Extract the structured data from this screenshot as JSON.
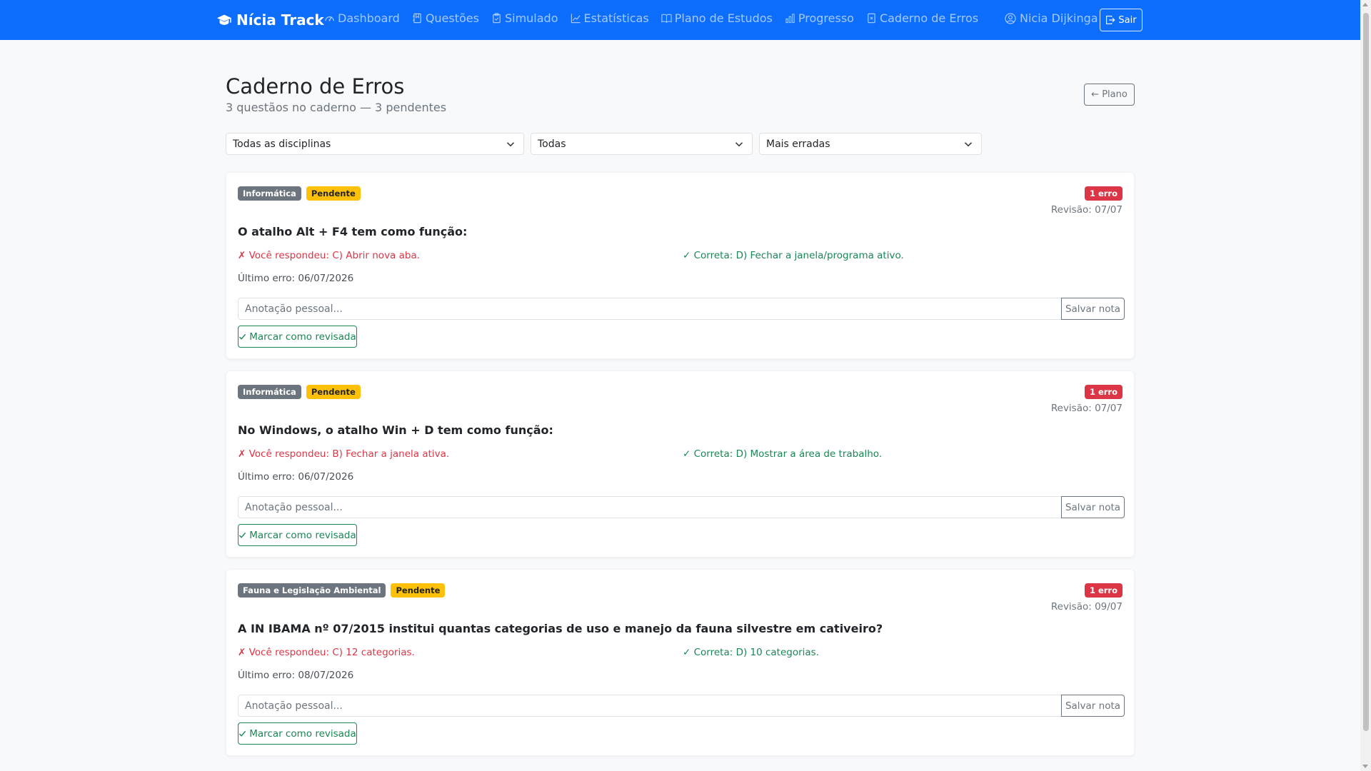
{
  "navbar": {
    "brand": "Nícia Track",
    "links": [
      {
        "label": "Dashboard",
        "icon": "speedometer-icon"
      },
      {
        "label": "Questões",
        "icon": "journal-icon"
      },
      {
        "label": "Simulado",
        "icon": "clipboard-icon"
      },
      {
        "label": "Estatísticas",
        "icon": "graph-up-icon"
      },
      {
        "label": "Plano de Estudos",
        "icon": "book-icon"
      },
      {
        "label": "Progresso",
        "icon": "bar-chart-icon"
      },
      {
        "label": "Caderno de Erros",
        "icon": "journal-x-icon"
      }
    ],
    "user": "Nicia Dijkinga",
    "logout": "Sair"
  },
  "header": {
    "title": "Caderno de Erros",
    "subtitle": "3 questãos no caderno — 3 pendentes",
    "back_button": "← Plano"
  },
  "filters": {
    "discipline": "Todas as disciplinas",
    "status": "Todas",
    "order": "Mais erradas"
  },
  "cards": [
    {
      "discipline": "Informática",
      "status": "Pendente",
      "errors": "1 erro",
      "revisao": "Revisão: 07/07",
      "question": "O atalho Alt + F4 tem como função:",
      "wrong": "✗ Você respondeu: C) Abrir nova aba.",
      "correct": "✓ Correta: D) Fechar a janela/programa ativo.",
      "last_error": "Último erro: 06/07/2026",
      "note_placeholder": "Anotação pessoal...",
      "save_label": "Salvar nota",
      "review_label": "Marcar como revisada"
    },
    {
      "discipline": "Informática",
      "status": "Pendente",
      "errors": "1 erro",
      "revisao": "Revisão: 07/07",
      "question": "No Windows, o atalho Win + D tem como função:",
      "wrong": "✗ Você respondeu: B) Fechar a janela ativa.",
      "correct": "✓ Correta: D) Mostrar a área de trabalho.",
      "last_error": "Último erro: 06/07/2026",
      "note_placeholder": "Anotação pessoal...",
      "save_label": "Salvar nota",
      "review_label": "Marcar como revisada"
    },
    {
      "discipline": "Fauna e Legislação Ambiental",
      "status": "Pendente",
      "errors": "1 erro",
      "revisao": "Revisão: 09/07",
      "question": "A IN IBAMA nº 07/2015 institui quantas categorias de uso e manejo da fauna silvestre em cativeiro?",
      "wrong": "✗ Você respondeu: C) 12 categorias.",
      "correct": "✓ Correta: D) 10 categorias.",
      "last_error": "Último erro: 08/07/2026",
      "note_placeholder": "Anotação pessoal...",
      "save_label": "Salvar nota",
      "review_label": "Marcar como revisada"
    }
  ],
  "colors": {
    "primary": "#0d6efd",
    "danger": "#dc3545",
    "success": "#198754",
    "warning": "#ffc107",
    "secondary": "#6c757d"
  }
}
